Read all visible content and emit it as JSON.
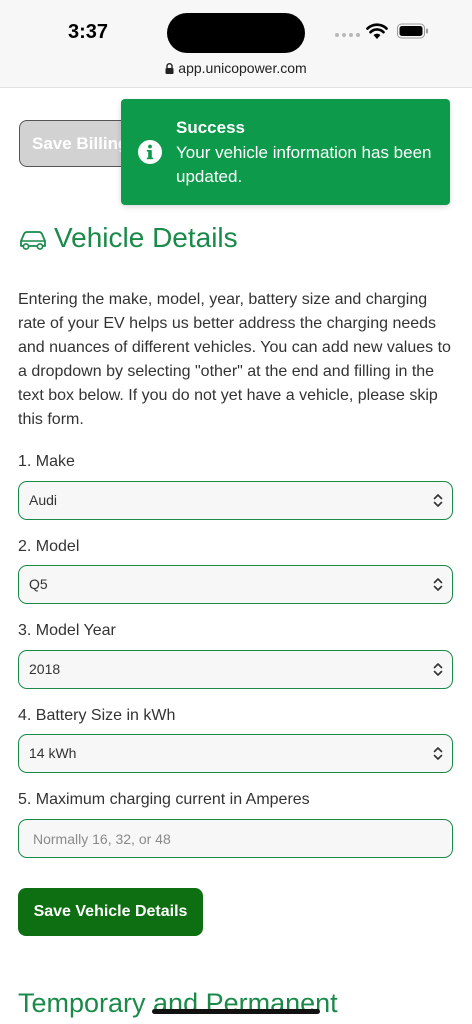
{
  "status_bar": {
    "time": "3:37",
    "url": "app.unicopower.com",
    "icons": [
      "signal-icon",
      "wifi-icon",
      "battery-icon",
      "lock-icon"
    ]
  },
  "billing": {
    "save_label": "Save Billing"
  },
  "toast": {
    "title": "Success",
    "message": "Your vehicle information has been updated.",
    "icon": "info-icon",
    "color": "#0d9a4b"
  },
  "section": {
    "title": "Vehicle Details",
    "icon": "car-icon",
    "description": "Entering the make, model, year, battery size and charging rate of your EV helps us better address the charging needs and nuances of different vehicles. You can add new values to a dropdown by selecting \"other\" at the end and filling in the text box below. If you do not yet have a vehicle, please skip this form."
  },
  "form": {
    "make": {
      "label": "1. Make",
      "value": "Audi"
    },
    "model": {
      "label": "2. Model",
      "value": "Q5"
    },
    "year": {
      "label": "3. Model Year",
      "value": "2018"
    },
    "battery": {
      "label": "4. Battery Size in kWh",
      "value": "14 kWh"
    },
    "current": {
      "label": "5. Maximum charging current in Amperes",
      "placeholder": "Normally 16, 32, or 48",
      "value": ""
    },
    "save_label": "Save Vehicle Details"
  },
  "next_section": {
    "title": "Temporary and Permanent"
  },
  "colors": {
    "accent": "#1a8a4a",
    "primary_button": "#0e6e12"
  }
}
